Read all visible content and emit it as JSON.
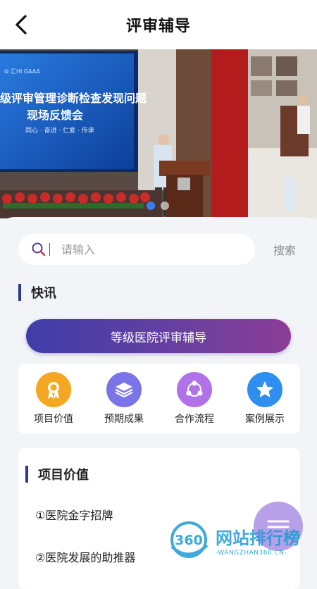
{
  "header": {
    "title": "评审辅导"
  },
  "banner": {
    "logo": "⦾ 汇HI GAAA",
    "line1": "级评审管理诊断检查发现问题",
    "line2": "现场反馈会",
    "line3": "同心 · 奋进 · 仁爱 · 传承",
    "slide_count": 2,
    "active_slide": 1
  },
  "search": {
    "placeholder": "请输入",
    "value": "",
    "button": "搜索"
  },
  "news": {
    "title": "快讯"
  },
  "cta": {
    "label": "等级医院评审辅导"
  },
  "quick_links": [
    {
      "label": "项目价值",
      "icon": "award-ribbon-icon",
      "color": "#f5a623"
    },
    {
      "label": "预期成果",
      "icon": "layers-icon",
      "color": "#7b74e8"
    },
    {
      "label": "合作流程",
      "icon": "share-nodes-icon",
      "color": "#b072e6"
    },
    {
      "label": "案例展示",
      "icon": "star-icon",
      "color": "#2f8ff0"
    }
  ],
  "project_value": {
    "title": "项目价值",
    "items": [
      "①医院金字招牌",
      "②医院发展的助推器"
    ]
  },
  "watermark": {
    "text": "网站排行榜",
    "sub": "-WANGZHAN360.CN-",
    "badge": "360"
  },
  "colors": {
    "accent": "#2c3a94",
    "cta_start": "#3e3ea8",
    "cta_end": "#8c3e95"
  }
}
